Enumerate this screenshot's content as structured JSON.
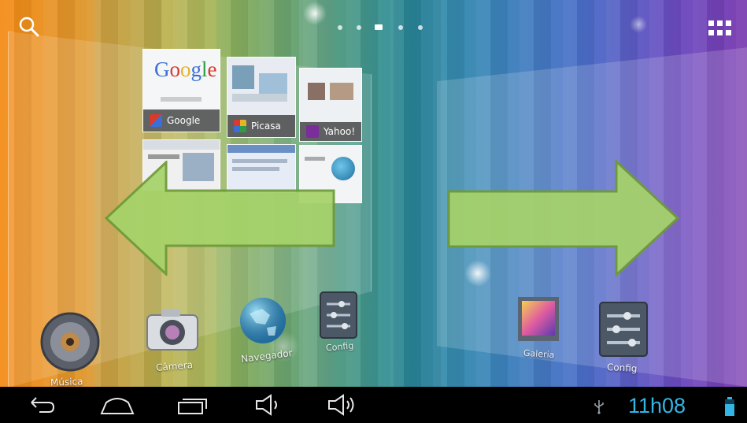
{
  "launcher": {
    "page_indicator": {
      "count": 5,
      "active": 3
    },
    "left_panel": {
      "widgets": [
        {
          "label": "Google",
          "logo_text": "Google"
        },
        {
          "label": "Picasa"
        },
        {
          "label": "Yahoo!"
        }
      ]
    },
    "apps": [
      {
        "label": "Música"
      },
      {
        "label": "Câmera"
      },
      {
        "label": "Navegador"
      },
      {
        "label": "Config"
      },
      {
        "label": "Galeria"
      },
      {
        "label": "Config"
      }
    ]
  },
  "status_bar": {
    "time": "11h08"
  },
  "colors": {
    "clock": "#33b5e5",
    "arrow_fill": "#a6d36a",
    "arrow_stroke": "#6e9b38"
  }
}
